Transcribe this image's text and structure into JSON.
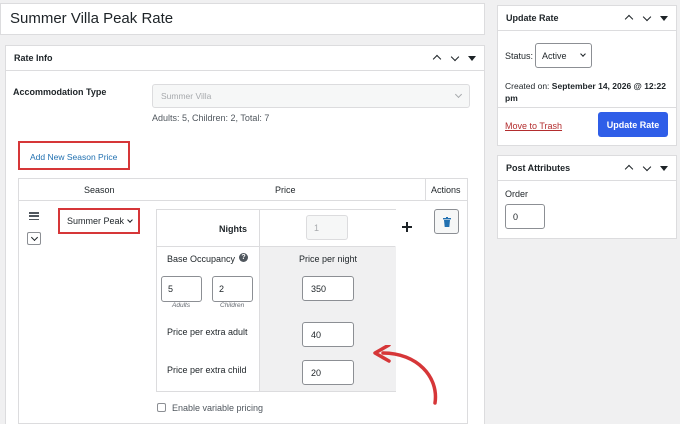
{
  "post_title": "Summer Villa Peak Rate",
  "rate_info": {
    "heading": "Rate Info",
    "accommodation_type_label": "Accommodation Type",
    "accommodation_type_value": "Summer Villa",
    "capacity_note": "Adults: 5, Children: 2, Total: 7",
    "add_season_price_label": "Add New Season Price",
    "columns": {
      "season": "Season",
      "price": "Price",
      "actions": "Actions"
    },
    "season_select_value": "Summer Peak",
    "nights_label": "Nights",
    "nights_value": "1",
    "base_occupancy_label": "Base Occupancy",
    "price_per_night_label": "Price per night",
    "adults_value": "5",
    "adults_label": "Adults",
    "children_value": "2",
    "children_label": "Children",
    "price_per_night_value": "350",
    "extra_adult_label": "Price per extra adult",
    "extra_adult_value": "40",
    "extra_child_label": "Price per extra child",
    "extra_child_value": "20",
    "variable_pricing_label": "Enable variable pricing",
    "variable_pricing_checked": false
  },
  "update_rate": {
    "heading": "Update Rate",
    "status_label": "Status:",
    "status_value": "Active",
    "created_on_label": "Created on:",
    "created_on_value": "September 14, 2026 @ 12:22 pm",
    "trash_label": "Move to Trash",
    "update_button_label": "Update Rate"
  },
  "post_attributes": {
    "heading": "Post Attributes",
    "order_label": "Order",
    "order_value": "0"
  },
  "colors": {
    "primary_button": "#2f5ee8",
    "highlight_red": "#d63638",
    "link_blue": "#2271b1",
    "trash_red": "#b32d2e"
  },
  "icons": [
    "drag-handle-icon",
    "chevron-down-icon",
    "help-icon",
    "plus-icon",
    "trash-icon",
    "curved-arrow-icon"
  ]
}
